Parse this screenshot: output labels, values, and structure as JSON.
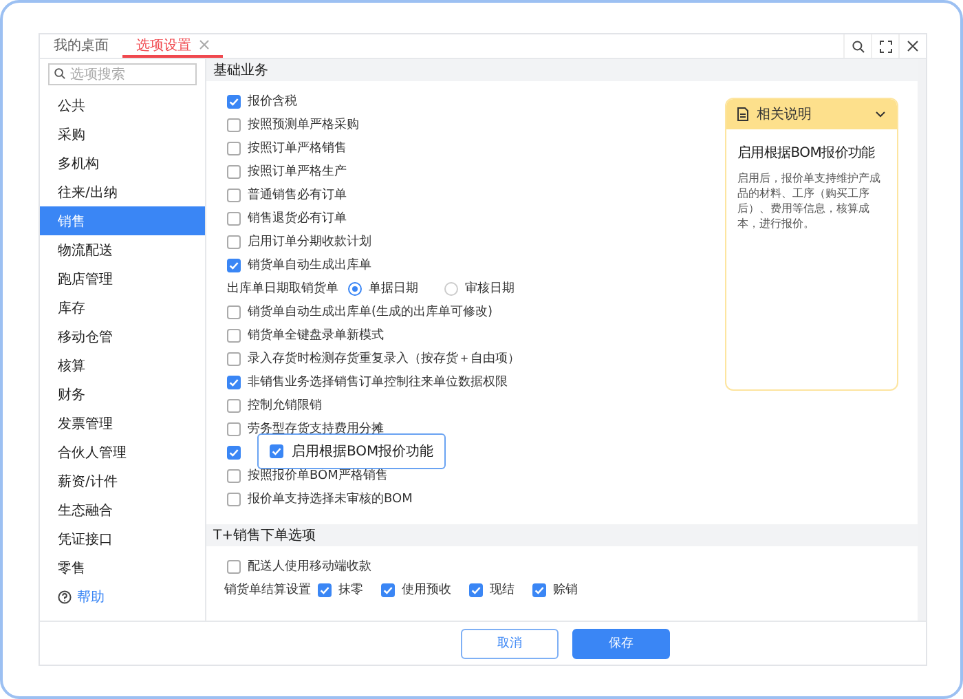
{
  "tabs": [
    {
      "label": "我的桌面",
      "selected": false,
      "closable": false
    },
    {
      "label": "选项设置",
      "selected": true,
      "closable": true
    }
  ],
  "toolbar": [
    {
      "kind": "search"
    },
    {
      "kind": "fullscreen"
    },
    {
      "kind": "close"
    }
  ],
  "sidebar": {
    "search": {
      "placeholder": "选项搜索"
    },
    "items": [
      {
        "label": "公共",
        "selected": false
      },
      {
        "label": "采购",
        "selected": false
      },
      {
        "label": "多机构",
        "selected": false
      },
      {
        "label": "往来/出纳",
        "selected": false
      },
      {
        "label": "销售",
        "selected": true
      },
      {
        "label": "物流配送",
        "selected": false
      },
      {
        "label": "跑店管理",
        "selected": false
      },
      {
        "label": "库存",
        "selected": false
      },
      {
        "label": "移动仓管",
        "selected": false
      },
      {
        "label": "核算",
        "selected": false
      },
      {
        "label": "财务",
        "selected": false
      },
      {
        "label": "发票管理",
        "selected": false
      },
      {
        "label": "合伙人管理",
        "selected": false
      },
      {
        "label": "薪资/计件",
        "selected": false
      },
      {
        "label": "生态融合",
        "selected": false
      },
      {
        "label": "凭证接口",
        "selected": false
      },
      {
        "label": "零售",
        "selected": false
      }
    ],
    "help": "帮助"
  },
  "sections": [
    {
      "title": "基础业务",
      "rows": [
        {
          "kind": "check",
          "label": "报价含税",
          "checked": true
        },
        {
          "kind": "check",
          "label": "按照预测单严格采购",
          "checked": false
        },
        {
          "kind": "check",
          "label": "按照订单严格销售",
          "checked": false
        },
        {
          "kind": "check",
          "label": "按照订单严格生产",
          "checked": false
        },
        {
          "kind": "check",
          "label": "普通销售必有订单",
          "checked": false
        },
        {
          "kind": "check",
          "label": "销售退货必有订单",
          "checked": false
        },
        {
          "kind": "check",
          "label": "启用订单分期收款计划",
          "checked": false
        },
        {
          "kind": "check",
          "label": "销货单自动生成出库单",
          "checked": true
        },
        {
          "kind": "radio",
          "label": "出库单日期取销货单",
          "options": [
            {
              "label": "单据日期",
              "selected": true
            },
            {
              "label": "审核日期",
              "selected": false
            }
          ]
        },
        {
          "kind": "check",
          "label": "销货单自动生成出库单(生成的出库单可修改)",
          "checked": false
        },
        {
          "kind": "check",
          "label": "销货单全键盘录单新模式",
          "checked": false
        },
        {
          "kind": "check",
          "label": "录入存货时检测存货重复录入（按存货＋自由项）",
          "checked": false
        },
        {
          "kind": "check",
          "label": "非销售业务选择销售订单控制往来单位数据权限",
          "checked": true
        },
        {
          "kind": "check",
          "label": "控制允销限销",
          "checked": false
        },
        {
          "kind": "check",
          "label": "劳务型存货支持费用分摊",
          "checked": false
        },
        {
          "kind": "callout",
          "checked": true,
          "callout": {
            "label": "启用根据BOM报价功能",
            "checked": true
          }
        },
        {
          "kind": "check",
          "label": "按照报价单BOM严格销售",
          "checked": false
        },
        {
          "kind": "check",
          "label": "报价单支持选择未审核的BOM",
          "checked": false
        }
      ]
    },
    {
      "title": "T+销售下单选项",
      "rows": [
        {
          "kind": "check",
          "label": "配送人使用移动端收款",
          "checked": false
        },
        {
          "kind": "multi",
          "label": "销货单结算设置",
          "options": [
            {
              "label": "抹零",
              "checked": true
            },
            {
              "label": "使用预收",
              "checked": true
            },
            {
              "label": "现结",
              "checked": true
            },
            {
              "label": "赊销",
              "checked": true
            }
          ]
        }
      ]
    }
  ],
  "help_panel": {
    "title": "相关说明",
    "expanded": true,
    "heading": "启用根据BOM报价功能",
    "body": "启用后，报价单支持维护产成品的材料、工序（购买工序后）、费用等信息，核算成本，进行报价。"
  },
  "buttons": [
    {
      "label": "取消",
      "kind": "secondary"
    },
    {
      "label": "保存",
      "kind": "primary"
    }
  ]
}
